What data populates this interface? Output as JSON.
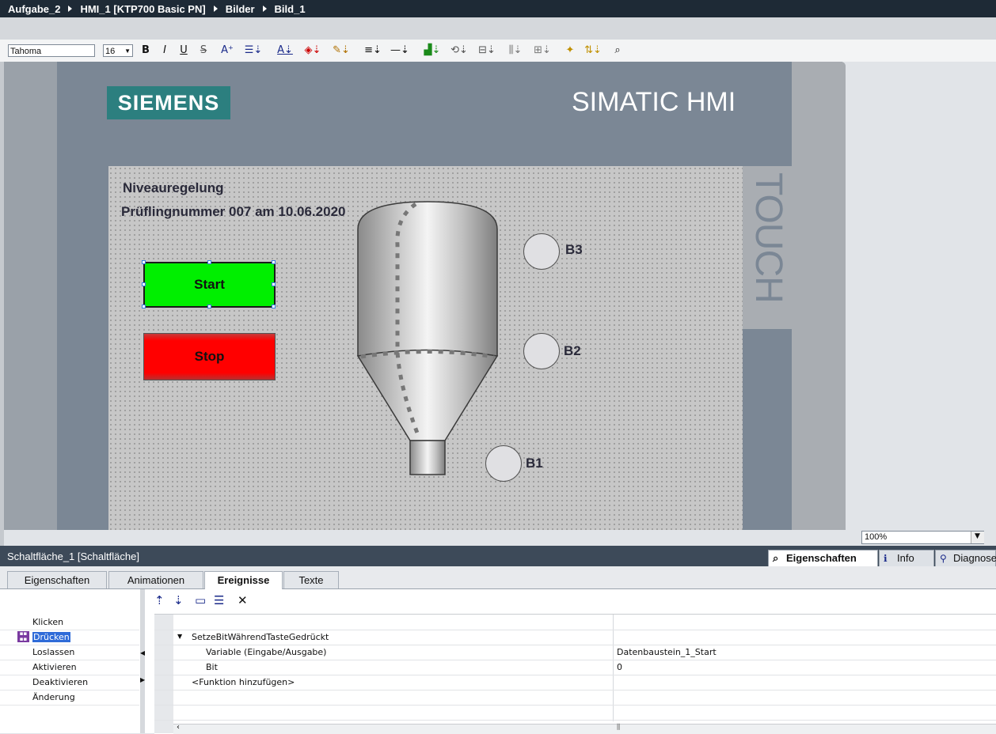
{
  "breadcrumb": [
    "Aufgabe_2",
    "HMI_1 [KTP700 Basic PN]",
    "Bilder",
    "Bild_1"
  ],
  "toolbar": {
    "font_name": "Tahoma",
    "font_size": "16",
    "bold": "B",
    "italic": "I",
    "underline": "U",
    "strike": "S"
  },
  "device": {
    "brand": "SIEMENS",
    "product": "SIMATIC HMI",
    "touch_label": "TOUCH"
  },
  "screen": {
    "title": "Niveauregelung",
    "subtitle": "Prüflingnummer 007 am 10.06.2020",
    "start_label": "Start",
    "stop_label": "Stop",
    "sensors": [
      "B3",
      "B2",
      "B1"
    ]
  },
  "zoom": "100%",
  "panel": {
    "title": "Schaltfläche_1 [Schaltfläche]",
    "top_tabs": [
      "Eigenschaften",
      "Info",
      "Diagnose"
    ],
    "tabs": [
      "Eigenschaften",
      "Animationen",
      "Ereignisse",
      "Texte"
    ],
    "active_tab": "Ereignisse",
    "events": [
      "Klicken",
      "Drücken",
      "Loslassen",
      "Aktivieren",
      "Deaktivieren",
      "Änderung"
    ],
    "selected_event": "Drücken",
    "function": "SetzeBitWährendTasteGedrückt",
    "rows": [
      {
        "label": "Variable (Eingabe/Ausgabe)",
        "value": "Datenbaustein_1_Start"
      },
      {
        "label": "Bit",
        "value": "0"
      }
    ],
    "add_function": "<Funktion hinzufügen>"
  }
}
